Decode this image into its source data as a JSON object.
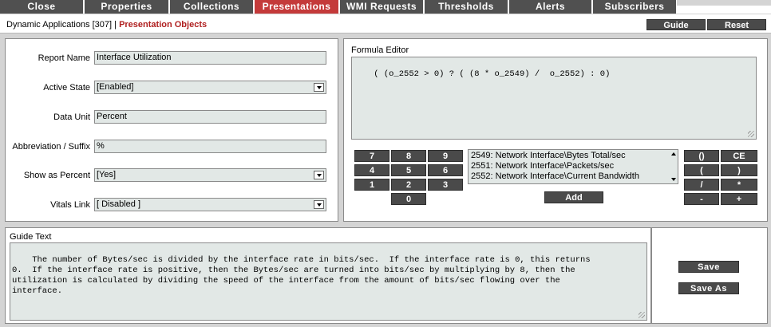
{
  "tabs": [
    {
      "label": "Close",
      "active": false
    },
    {
      "label": "Properties",
      "active": false
    },
    {
      "label": "Collections",
      "active": false
    },
    {
      "label": "Presentations",
      "active": true
    },
    {
      "label": "WMI Requests",
      "active": false
    },
    {
      "label": "Thresholds",
      "active": false
    },
    {
      "label": "Alerts",
      "active": false
    },
    {
      "label": "Subscribers",
      "active": false
    }
  ],
  "header": {
    "breadcrumb_parent": "Dynamic Applications [307]",
    "breadcrumb_separator": "|",
    "breadcrumb_current": "Presentation Objects",
    "guide_label": "Guide",
    "reset_label": "Reset"
  },
  "form": {
    "report_name_label": "Report Name",
    "report_name_value": "Interface Utilization",
    "active_state_label": "Active State",
    "active_state_value": "[Enabled]",
    "data_unit_label": "Data Unit",
    "data_unit_value": "Percent",
    "abbreviation_label": "Abbreviation / Suffix",
    "abbreviation_value": "%",
    "show_percent_label": "Show as Percent",
    "show_percent_value": "[Yes]",
    "vitals_link_label": "Vitals Link",
    "vitals_link_value": "[ Disabled ]"
  },
  "formula": {
    "title": "Formula Editor",
    "value": "( (o_2552 > 0) ? ( (8 * o_2549) /  o_2552) : 0)",
    "keypad": [
      "7",
      "8",
      "9",
      "4",
      "5",
      "6",
      "1",
      "2",
      "3",
      "0"
    ],
    "objects": [
      "2549: Network Interface\\Bytes Total/sec",
      "2551: Network Interface\\Packets/sec",
      "2552: Network Interface\\Current Bandwidth"
    ],
    "add_label": "Add",
    "operators": [
      "()",
      "CE",
      "(",
      ")",
      "/",
      "*",
      "-",
      "+"
    ]
  },
  "guide": {
    "title": "Guide Text",
    "value": "The number of Bytes/sec is divided by the interface rate in bits/sec.  If the interface rate is 0, this returns\n0.  If the interface rate is positive, then the Bytes/sec are turned into bits/sec by multiplying by 8, then the\nutilization is calculated by dividing the speed of the interface from the amount of bits/sec flowing over the\ninterface."
  },
  "actions": {
    "save_label": "Save",
    "save_as_label": "Save As"
  },
  "colors": {
    "tab_bg": "#505050",
    "tab_active_bg": "#c43a3a",
    "breadcrumb_current": "#b02020",
    "field_bg": "#e2e8e6"
  }
}
